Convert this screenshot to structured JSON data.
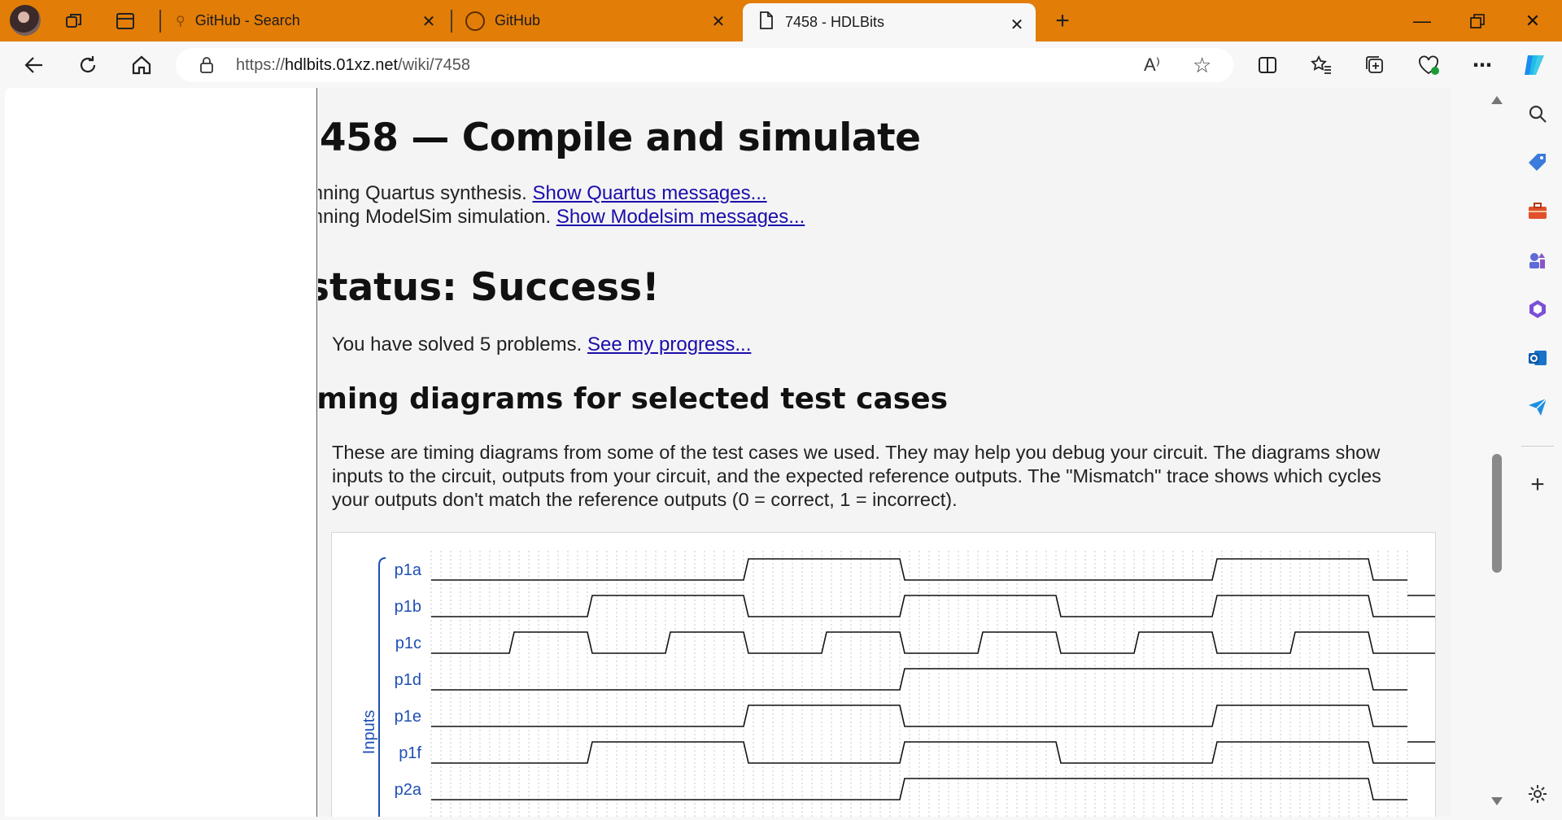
{
  "browser": {
    "tabs": [
      {
        "label": "GitHub - Search",
        "icon": "search-icon"
      },
      {
        "label": "GitHub",
        "icon": "github-icon"
      },
      {
        "label": "7458 - HDLBits",
        "icon": "page-icon",
        "active": true
      }
    ],
    "url_scheme": "https://",
    "url_host": "hdlbits.01xz.net",
    "url_path": "/wiki/7458"
  },
  "page": {
    "title": "'458 — Compile and simulate",
    "quartus_text": "ınning Quartus synthesis. ",
    "quartus_link": "Show Quartus messages...",
    "modelsim_text": "ınning ModelSim simulation. ",
    "modelsim_link": "Show Modelsim messages...",
    "status": "ꜱtatus: Success!",
    "solved_text": "You have solved 5 problems. ",
    "progress_link": "See my progress...",
    "timing_title": "iming diagrams for selected test cases",
    "description": "These are timing diagrams from some of the test cases we used. They may help you debug your circuit. The diagrams show inputs to the circuit, outputs from your circuit, and the expected reference outputs. The \"Mismatch\" trace shows which cycles your outputs don't match the reference outputs (0 = correct, 1 = incorrect)."
  },
  "timing": {
    "group_label": "Inputs",
    "signal_color": "#1f4fb4",
    "signals": [
      {
        "name": "p1a",
        "levels": [
          0,
          0,
          0,
          0,
          0,
          0,
          0,
          0,
          1,
          1,
          1,
          1,
          0,
          0,
          0,
          0,
          0,
          0,
          0,
          0,
          1,
          1,
          1,
          1,
          0,
          0,
          0,
          0
        ]
      },
      {
        "name": "p1b",
        "levels": [
          0,
          0,
          0,
          0,
          1,
          1,
          1,
          1,
          0,
          0,
          0,
          0,
          1,
          1,
          1,
          1,
          0,
          0,
          0,
          0,
          1,
          1,
          1,
          1,
          0,
          0,
          0,
          0,
          1
        ]
      },
      {
        "name": "p1c",
        "levels": [
          0,
          0,
          1,
          1,
          0,
          0,
          1,
          1,
          0,
          0,
          1,
          1,
          0,
          0,
          1,
          1,
          0,
          0,
          1,
          1,
          0,
          0,
          1,
          1,
          0,
          0,
          1,
          1,
          0
        ]
      },
      {
        "name": "p1d",
        "levels": [
          0,
          0,
          0,
          0,
          0,
          0,
          0,
          0,
          0,
          0,
          0,
          0,
          1,
          1,
          1,
          1,
          1,
          1,
          1,
          1,
          1,
          1,
          1,
          1,
          0,
          0,
          0,
          0
        ]
      },
      {
        "name": "p1e",
        "levels": [
          0,
          0,
          0,
          0,
          0,
          0,
          0,
          0,
          1,
          1,
          1,
          1,
          0,
          0,
          0,
          0,
          0,
          0,
          0,
          0,
          1,
          1,
          1,
          1,
          0,
          0,
          0,
          0
        ]
      },
      {
        "name": "p1f",
        "levels": [
          0,
          0,
          0,
          0,
          1,
          1,
          1,
          1,
          0,
          0,
          0,
          0,
          1,
          1,
          1,
          1,
          0,
          0,
          0,
          0,
          1,
          1,
          1,
          1,
          0,
          0,
          0,
          0,
          1
        ]
      },
      {
        "name": "p2a",
        "levels": [
          0,
          0,
          0,
          0,
          0,
          0,
          0,
          0,
          0,
          0,
          0,
          0,
          1,
          1,
          1,
          1,
          1,
          1,
          1,
          1,
          1,
          1,
          1,
          1,
          0,
          0,
          0,
          0
        ]
      }
    ]
  }
}
